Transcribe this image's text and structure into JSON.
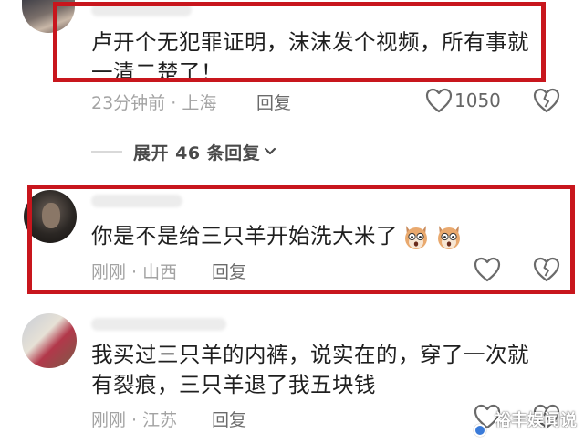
{
  "comments": [
    {
      "text_line1": "卢开个无犯罪证明，沫沫发个视频，所有事就",
      "text_line2": "一清二楚了！",
      "time": "23分钟前",
      "location": "上海",
      "reply_label": "回复",
      "like_count": "1050",
      "expand_label": "展开 46 条回复"
    },
    {
      "text_line1": "你是不是给三只羊开始洗大米了",
      "emoji": [
        "dog-emoji",
        "dog-emoji"
      ],
      "time": "刚刚",
      "location": "山西",
      "reply_label": "回复",
      "like_count": ""
    },
    {
      "text_line1": "我买过三只羊的内裤，说实在的，穿了一次就",
      "text_line2": "有裂痕，三只羊退了我五块钱",
      "time": "刚刚",
      "location": "江苏",
      "reply_label": "回复",
      "like_count": ""
    }
  ],
  "separator": " · ",
  "watermark": "裕丰娱闻说",
  "colors": {
    "highlight": "#c8161d",
    "text": "#1f1f1f",
    "meta": "#a3a3a3"
  }
}
